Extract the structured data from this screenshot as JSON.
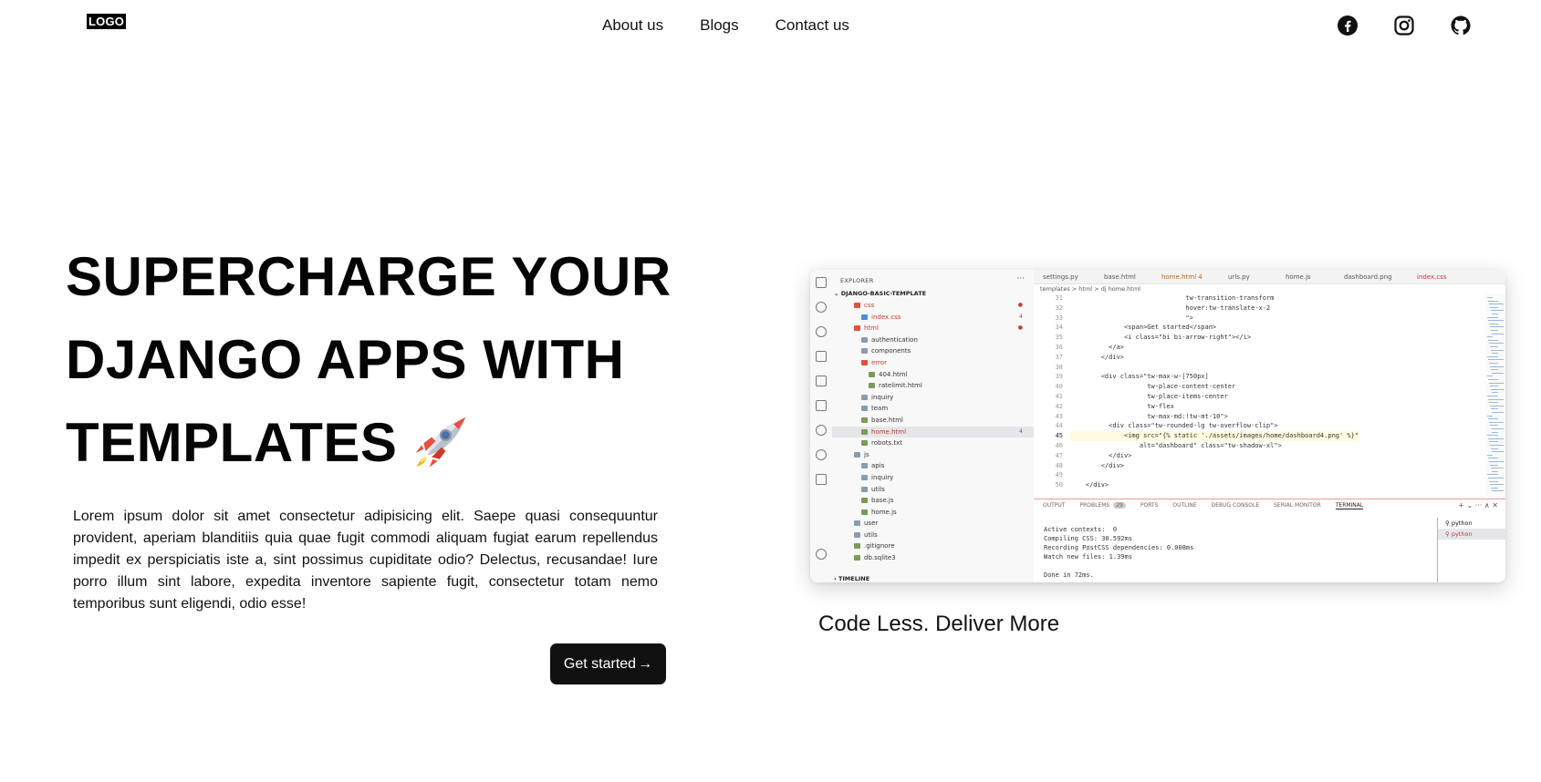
{
  "nav": {
    "logo": "LOGO",
    "links": [
      "About us",
      "Blogs",
      "Contact us"
    ],
    "social_icons": [
      "facebook-icon",
      "instagram-icon",
      "github-icon"
    ]
  },
  "hero": {
    "title_lines": [
      "SUPERCHARGE YOUR",
      "DJANGO APPS WITH",
      "TEMPLATES"
    ],
    "title_emoji": "rocket-icon",
    "description": "Lorem ipsum dolor sit amet consectetur adipisicing elit. Saepe quasi consequuntur provident, aperiam blanditiis quia quae fugit commodi aliquam fugiat earum repellendus impedit ex perspiciatis iste a, sint possimus cupiditate odio? Delectus, recusandae! Iure porro illum sint labore, expedita inventore sapiente fugit, consectetur totam nemo temporibus sunt eligendi, odio esse!",
    "cta_label": "Get started",
    "cta_arrow": "→"
  },
  "screenshot": {
    "explorer_title": "EXPLORER",
    "explorer_dots": "···",
    "project": "DJANGO-BASIC-TEMPLATE",
    "timeline": "TIMELINE",
    "tree": [
      {
        "label": "css",
        "red": true,
        "badge": "●"
      },
      {
        "label": "index.css",
        "red": true,
        "badge": "4"
      },
      {
        "label": "html",
        "red": true,
        "badge": "●"
      },
      {
        "label": "authentication"
      },
      {
        "label": "components"
      },
      {
        "label": "error",
        "red": true
      },
      {
        "label": "404.html"
      },
      {
        "label": "ratelimit.html"
      },
      {
        "label": "inquiry"
      },
      {
        "label": "team"
      },
      {
        "label": "base.html"
      },
      {
        "label": "home.html",
        "selected": true,
        "badge": "4"
      },
      {
        "label": "robots.txt"
      },
      {
        "label": "js"
      },
      {
        "label": "apis"
      },
      {
        "label": "inquiry"
      },
      {
        "label": "utils"
      },
      {
        "label": "base.js"
      },
      {
        "label": "home.js"
      },
      {
        "label": "user"
      },
      {
        "label": "utils"
      },
      {
        "label": ".gitignore"
      },
      {
        "label": "db.sqlite3"
      }
    ],
    "tabs": [
      "settings.py",
      "base.html",
      "home.html 4",
      "urls.py",
      "home.js",
      "dashboard.png",
      "index.css"
    ],
    "breadcrumb": "templates > html > dj home.html",
    "line_numbers": [
      "31",
      "32",
      "33",
      "34",
      "35",
      "36",
      "37",
      "38",
      "39",
      "40",
      "41",
      "42",
      "43",
      "44",
      "45",
      "46",
      "47",
      "48",
      "49",
      "50"
    ],
    "code_lines": [
      "                              tw-transition-transform",
      "                              hover:tw-translate-x-2",
      "                              \">",
      "              <span>Get started</span>",
      "              <i class=\"bi bi-arrow-right\"></i>",
      "          </a>",
      "        </div>",
      "",
      "        <div class=\"tw-max-w-[750px]",
      "                    tw-place-content-center",
      "                    tw-place-items-center",
      "                    tw-flex",
      "                    tw-max-md:!tw-mt-10\">",
      "          <div class=\"tw-rounded-lg tw-overflow-clip\">",
      "              <img src=\"{% static './assets/images/home/dashboard4.png' %}\"",
      "                  alt=\"dashboard\" class=\"tw-shadow-xl\">",
      "          </div>",
      "        </div>",
      "",
      "    </div>"
    ],
    "panel_tabs": [
      "OUTPUT",
      "PROBLEMS",
      "29",
      "PORTS",
      "OUTLINE",
      "DEBUG CONSOLE",
      "SERIAL MONITOR",
      "TERMINAL"
    ],
    "panel_controls": "+ ⌄ ··· ∧ ✕",
    "terminal_lines": [
      "Active contexts:  0",
      "Compiling CSS: 30.592ms",
      "Recording PostCSS dependencies: 0.008ms",
      "Watch new files: 1.39ms",
      "",
      "Done in 72ms."
    ],
    "shells": [
      "python",
      "python"
    ]
  },
  "caption": "Code Less. Deliver More"
}
